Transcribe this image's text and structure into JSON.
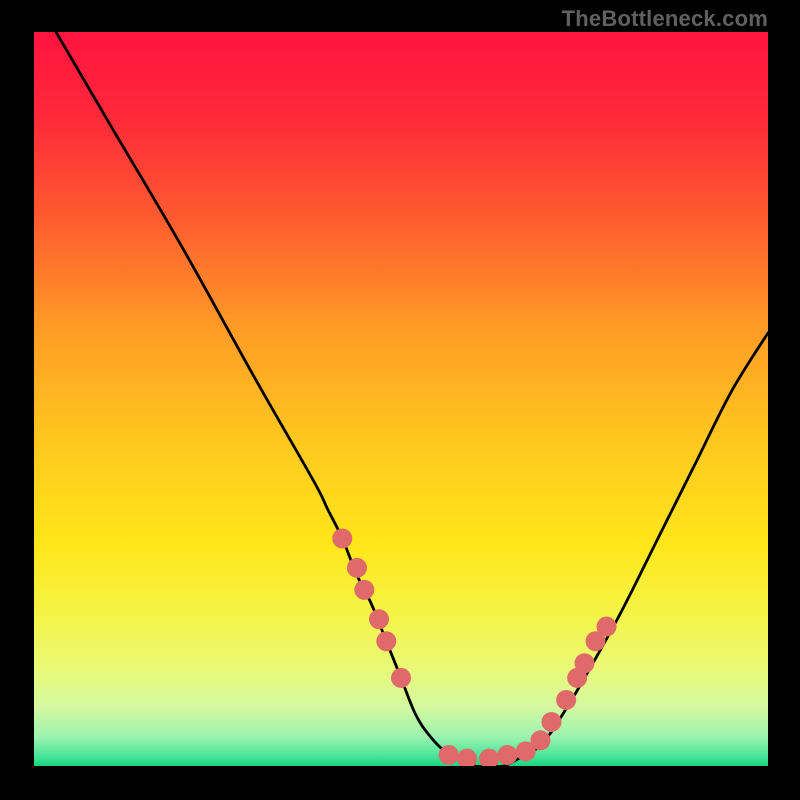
{
  "watermark": "TheBottleneck.com",
  "chart_data": {
    "type": "line",
    "title": "",
    "xlabel": "",
    "ylabel": "",
    "xlim": [
      0,
      100
    ],
    "ylim": [
      0,
      100
    ],
    "grid": false,
    "series": [
      {
        "name": "curve",
        "x": [
          3,
          10,
          20,
          30,
          38,
          40,
          42,
          44,
          46,
          48,
          50,
          52,
          54,
          56,
          58,
          60,
          62,
          64,
          66,
          68,
          70,
          72,
          75,
          80,
          85,
          90,
          95,
          100
        ],
        "y": [
          100,
          88,
          71,
          53,
          39,
          35,
          31,
          26,
          22,
          17,
          12,
          7,
          4,
          2,
          1,
          0,
          0,
          0,
          1,
          2,
          4,
          7,
          12,
          21,
          31,
          41,
          51,
          59
        ]
      }
    ],
    "highlight_points": [
      {
        "x": 42,
        "y": 31
      },
      {
        "x": 44,
        "y": 27
      },
      {
        "x": 45,
        "y": 24
      },
      {
        "x": 47,
        "y": 20
      },
      {
        "x": 48,
        "y": 17
      },
      {
        "x": 50,
        "y": 12
      },
      {
        "x": 56.5,
        "y": 1.5
      },
      {
        "x": 59,
        "y": 1
      },
      {
        "x": 62,
        "y": 1
      },
      {
        "x": 64.5,
        "y": 1.5
      },
      {
        "x": 67,
        "y": 2
      },
      {
        "x": 69,
        "y": 3.5
      },
      {
        "x": 70.5,
        "y": 6
      },
      {
        "x": 72.5,
        "y": 9
      },
      {
        "x": 74,
        "y": 12
      },
      {
        "x": 75,
        "y": 14
      },
      {
        "x": 76.5,
        "y": 17
      },
      {
        "x": 78,
        "y": 19
      }
    ],
    "gradient_stops": [
      {
        "offset": 0.0,
        "color": "#ff133f"
      },
      {
        "offset": 0.12,
        "color": "#ff2a3a"
      },
      {
        "offset": 0.25,
        "color": "#ff5a2f"
      },
      {
        "offset": 0.4,
        "color": "#ff9a26"
      },
      {
        "offset": 0.55,
        "color": "#ffc61f"
      },
      {
        "offset": 0.7,
        "color": "#ffe61a"
      },
      {
        "offset": 0.8,
        "color": "#f3f54a"
      },
      {
        "offset": 0.87,
        "color": "#e9f97a"
      },
      {
        "offset": 0.92,
        "color": "#d4f9a0"
      },
      {
        "offset": 0.96,
        "color": "#9cf3b0"
      },
      {
        "offset": 0.985,
        "color": "#4ee59a"
      },
      {
        "offset": 1.0,
        "color": "#18d67e"
      }
    ],
    "curve_color": "#000000",
    "marker_color": "#e06a6a",
    "marker_radius": 10
  }
}
